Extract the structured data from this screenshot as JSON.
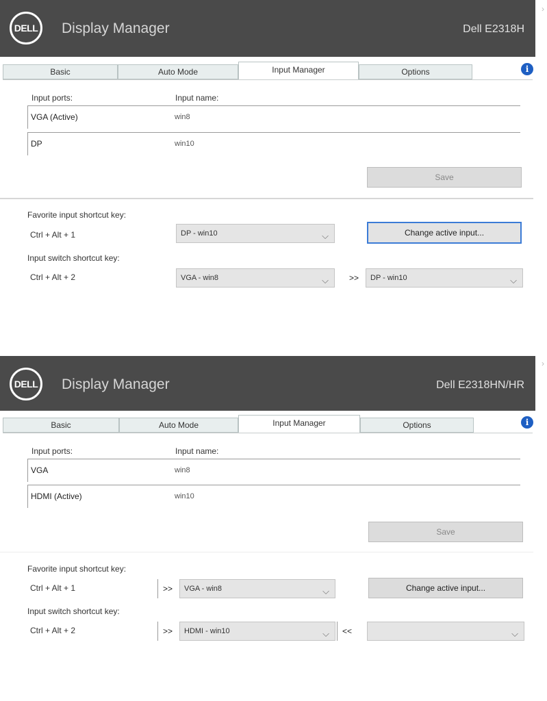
{
  "panels": [
    {
      "app_title": "Display Manager",
      "logo": "DELL",
      "model": "Dell E2318H",
      "chevron": "›",
      "tabs": [
        "Basic",
        "Auto Mode",
        "Input Manager",
        "Options"
      ],
      "active_tab": "Input Manager",
      "info_icon": "i",
      "headers": {
        "port": "Input ports:",
        "name": "Input name:"
      },
      "rows": [
        {
          "port": "VGA (Active)",
          "name": "win8"
        },
        {
          "port": "DP",
          "name": "win10"
        }
      ],
      "save_label": "Save",
      "favorite_label": "Favorite input shortcut key:",
      "favorite_keys": "Ctrl + Alt + 1",
      "favorite_value": "DP - win10",
      "change_label": "Change active input...",
      "switch_label": "Input switch shortcut key:",
      "switch_keys": "Ctrl + Alt + 2",
      "switch_from": "VGA - win8",
      "switch_arrow": ">>",
      "switch_to": "DP - win10"
    },
    {
      "app_title": "Display Manager",
      "logo": "DELL",
      "model": "Dell E2318HN/HR",
      "chevron": "›",
      "tabs": [
        "Basic",
        "Auto Mode",
        "Input Manager",
        "Options"
      ],
      "active_tab": "Input Manager",
      "info_icon": "i",
      "headers": {
        "port": "Input ports:",
        "name": "Input name:"
      },
      "rows": [
        {
          "port": "VGA",
          "name": "win8"
        },
        {
          "port": "HDMI (Active)",
          "name": "win10"
        }
      ],
      "save_label": "Save",
      "favorite_label": "Favorite input shortcut key:",
      "favorite_keys": "Ctrl + Alt + 1",
      "favorite_arrow": ">>",
      "favorite_value": "VGA - win8",
      "change_label": "Change active input...",
      "switch_label": "Input switch shortcut key:",
      "switch_keys": "Ctrl + Alt + 2",
      "switch_arrow_left": ">>",
      "switch_from": "HDMI - win10",
      "switch_arrow": "<<",
      "switch_to": ""
    }
  ],
  "colors": {
    "titlebar": "#4a4a4a",
    "accent": "#3b7bd6",
    "info": "#1e5fc3"
  }
}
